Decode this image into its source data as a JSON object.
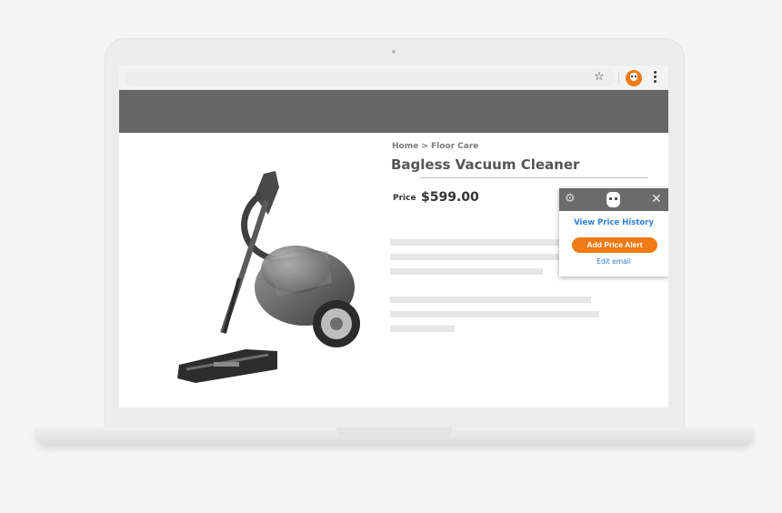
{
  "browser": {
    "star_icon": "star-icon",
    "extension_icon": "extension-logo-icon",
    "menu_icon": "more-menu-icon"
  },
  "page": {
    "breadcrumb": "Home > Floor Care",
    "title": "Bagless Vacuum Cleaner",
    "price_label": "Price",
    "price": "$599.00"
  },
  "popup": {
    "settings_icon": "gear-icon",
    "close_icon": "close-icon",
    "view_history": "View Price History",
    "add_alert": "Add Price Alert",
    "edit_email": "Edit email"
  },
  "colors": {
    "accent": "#f07b16",
    "link": "#2f80d6",
    "header": "#666666",
    "popup_header": "#6b6b6b"
  }
}
